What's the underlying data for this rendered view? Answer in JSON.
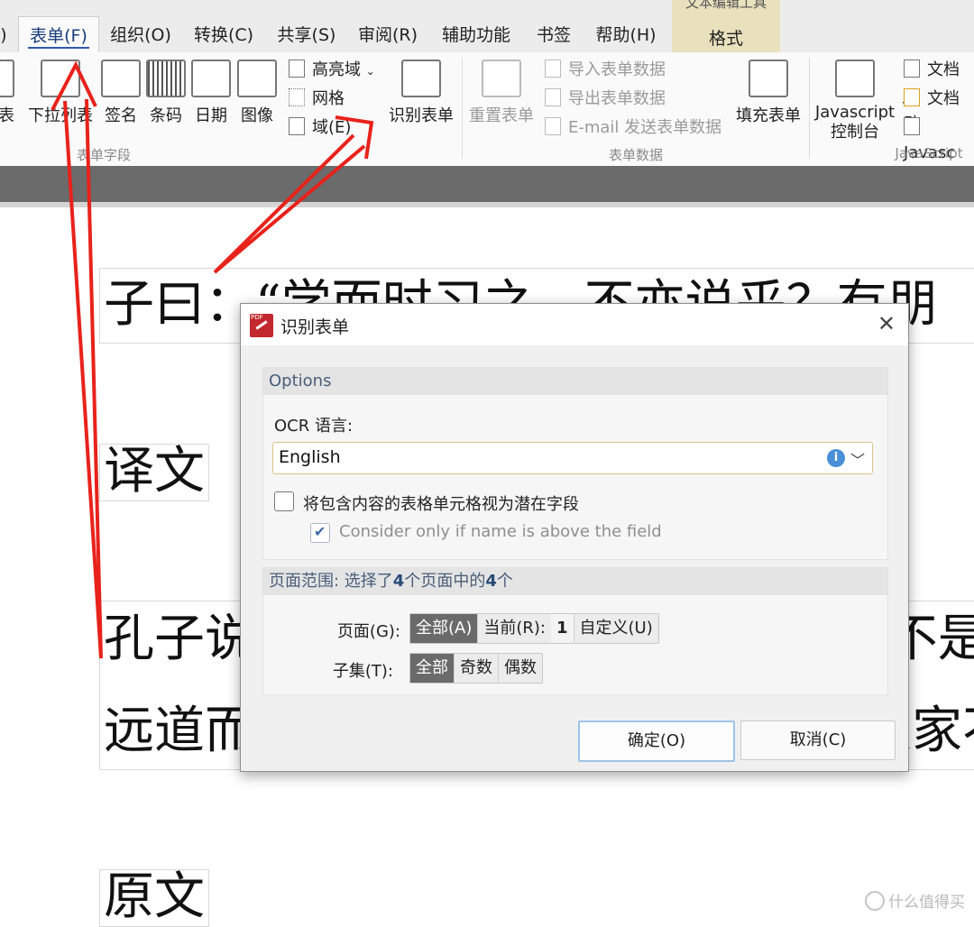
{
  "menu": {
    "items": [
      ")",
      "表单(F)",
      "组织(O)",
      "转换(C)",
      "共享(S)",
      "审阅(R)",
      "辅助功能",
      "书签",
      "帮助(H)"
    ],
    "context_group_title": "文本编辑工具",
    "context_tab": "格式"
  },
  "ribbon": {
    "form_fields": {
      "partial_label": "表",
      "buttons": [
        "下拉列表",
        "签名",
        "条码",
        "日期",
        "图像"
      ],
      "small_items": [
        "高亮域",
        "网格",
        "域(E)"
      ],
      "recognize": "识别表单",
      "group_label": "表单字段"
    },
    "form_data": {
      "reset": "重置表单",
      "small_items": [
        "导入表单数据",
        "导出表单数据",
        "E-mail 发送表单数据"
      ],
      "fill": "填充表单",
      "group_label": "表单数据"
    },
    "javascript": {
      "console_line1": "Javascript",
      "console_line2": "控制台",
      "small_items": [
        "文档 Ja",
        "文档动",
        "Javasc"
      ],
      "group_label": "JavaScript"
    }
  },
  "document": {
    "line1": "子曰：“学而时习之，不亦说乎？有朋",
    "heading_translation": "译文",
    "line2": "孔子说：“学了又时常温习和练习，不是很愉快吗？有志同道合的人从",
    "line3": "远道而来，不是很令人高兴的吗？人家不了解我，我也不怨恨、恼怒，不也是一个有德的君子吗？另",
    "heading_original": "原文"
  },
  "dialog": {
    "title": "识别表单",
    "options_header": "Options",
    "ocr_label": "OCR 语言:",
    "ocr_value": "English",
    "checkbox1_label": "将包含内容的表格单元格视为潜在字段",
    "checkbox1_checked": false,
    "checkbox2_label": "Consider only if name is above the field",
    "checkbox2_checked": true,
    "range_header_prefix": "页面范围: 选择了",
    "range_count_selected": "4",
    "range_header_middle": "个页面中的",
    "range_count_total": "4",
    "range_header_suffix": "个",
    "pages_label": "页面(G):",
    "pages_options": {
      "all": "全部(A)",
      "current": "当前(R):",
      "current_num": "1",
      "custom": "自定义(U)"
    },
    "pages_selected": "全部(A)",
    "subset_label": "子集(T):",
    "subset_options": {
      "all": "全部",
      "odd": "奇数",
      "even": "偶数"
    },
    "subset_selected": "全部",
    "ok": "确定(O)",
    "cancel": "取消(C)"
  },
  "watermark": "什么值得买",
  "colors": {
    "arrow": "#e8221b",
    "selected_segment": "#6a6a6a",
    "ok_border": "#9ec3e6",
    "context_tab": "#e9e1bd"
  }
}
